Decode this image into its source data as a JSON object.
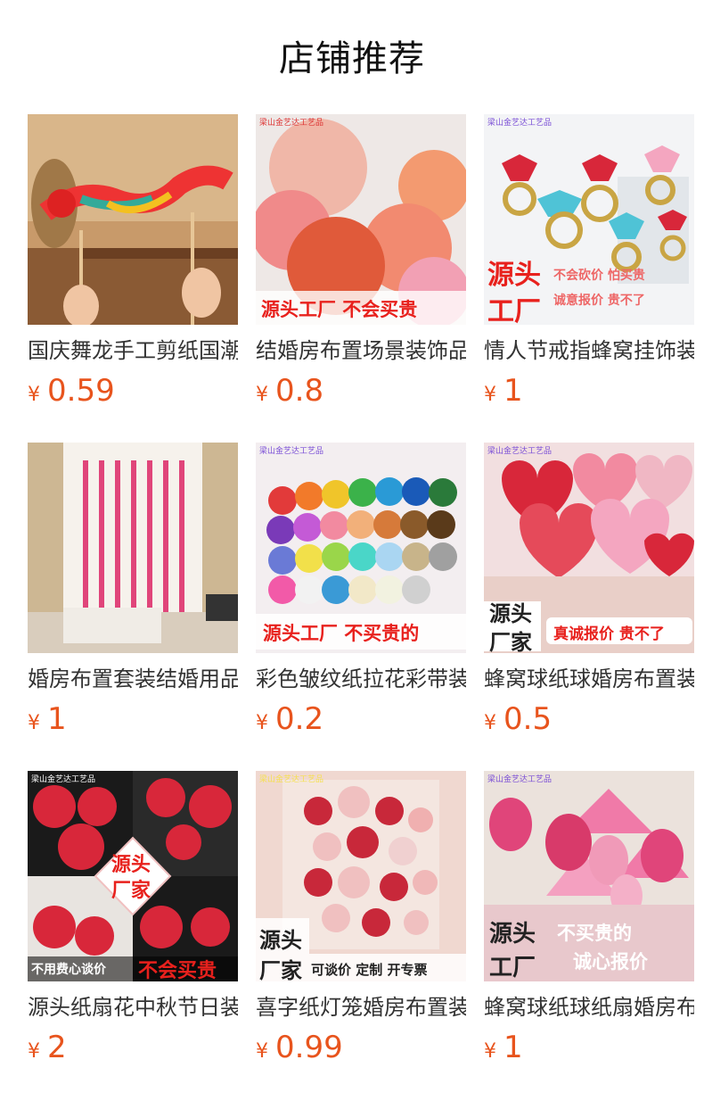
{
  "header": {
    "title": "店铺推荐"
  },
  "currency": "¥",
  "products": [
    {
      "title": "国庆舞龙手工剪纸国潮",
      "price": "0.59",
      "icon": "paper-dragon-image",
      "overlay": [],
      "shop": ""
    },
    {
      "title": "结婚房布置场景装饰品",
      "price": "0.8",
      "icon": "paper-lantern-balls-image",
      "overlay": [
        "源头工厂 不会买贵"
      ],
      "shop": "梁山金艺达工艺品"
    },
    {
      "title": "情人节戒指蜂窝挂饰装",
      "price": "1",
      "icon": "ring-honeycomb-image",
      "overlay": [
        "源头",
        "工厂",
        "不会砍价 怕买贵",
        "诚意报价 贵不了"
      ],
      "shop": "梁山金艺达工艺品"
    },
    {
      "title": "婚房布置套装结婚用品",
      "price": "1",
      "icon": "butterfly-curtain-image",
      "overlay": [],
      "shop": ""
    },
    {
      "title": "彩色皱纹纸拉花彩带装",
      "price": "0.2",
      "icon": "crepe-paper-rolls-image",
      "overlay": [
        "源头工厂 不买贵的"
      ],
      "shop": "梁山金艺达工艺品"
    },
    {
      "title": "蜂窝球纸球婚房布置装",
      "price": "0.5",
      "icon": "heart-honeycomb-image",
      "overlay": [
        "源头",
        "厂家",
        "真诚报价 贵不了"
      ],
      "shop": "梁山金艺达工艺品"
    },
    {
      "title": "源头纸扇花中秋节日装",
      "price": "2",
      "icon": "paper-fan-flowers-image",
      "overlay": [
        "源头",
        "厂家",
        "不用费心谈价",
        "不会买贵"
      ],
      "shop": "梁山金艺达工艺品"
    },
    {
      "title": "喜字纸灯笼婚房布置装",
      "price": "0.99",
      "icon": "xi-lantern-wall-image",
      "overlay": [
        "源头",
        "厂家",
        "可谈价 定制 开专票"
      ],
      "shop": "梁山金艺达工艺品"
    },
    {
      "title": "蜂窝球纸球纸扇婚房布",
      "price": "1",
      "icon": "pink-fan-lantern-image",
      "overlay": [
        "源头",
        "工厂",
        "不买贵的",
        "诚心报价"
      ],
      "shop": "梁山金艺达工艺品"
    }
  ],
  "colors": {
    "price": "#e8541d",
    "banner_red": "#e8211d"
  }
}
